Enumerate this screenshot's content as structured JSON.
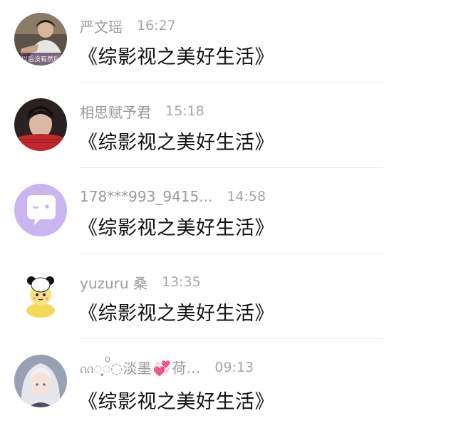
{
  "comments": [
    {
      "name": "严文瑶",
      "time": "16:27",
      "text": "《综影视之美好生活》",
      "avatar": "avatar-photo-man-sitting"
    },
    {
      "name": "相思赋予君",
      "time": "15:18",
      "text": "《综影视之美好生活》",
      "avatar": "avatar-photo-man-fan"
    },
    {
      "name": "178***993_9415...",
      "time": "14:58",
      "text": "《综影视之美好生活》",
      "avatar": "default-chat-bubble-icon"
    },
    {
      "name": "yuzuru 桑",
      "time": "13:35",
      "text": "《综影视之美好生活》",
      "avatar": "avatar-cartoon-panda"
    },
    {
      "name_prefix": "ᦶ◌̥͙◌ͦ◌淡墨",
      "name_suffix": "荷…",
      "time": "09:13",
      "text": "《综影视之美好生活》",
      "avatar": "avatar-anime-girl"
    }
  ],
  "avatar_overlay_text": "以后没有然后",
  "colors": {
    "name": "#9a9a9a",
    "time": "#a6a6a6",
    "message": "#111111",
    "default_avatar_bg": "#c9b6f1",
    "heart": "#d84fa8"
  }
}
